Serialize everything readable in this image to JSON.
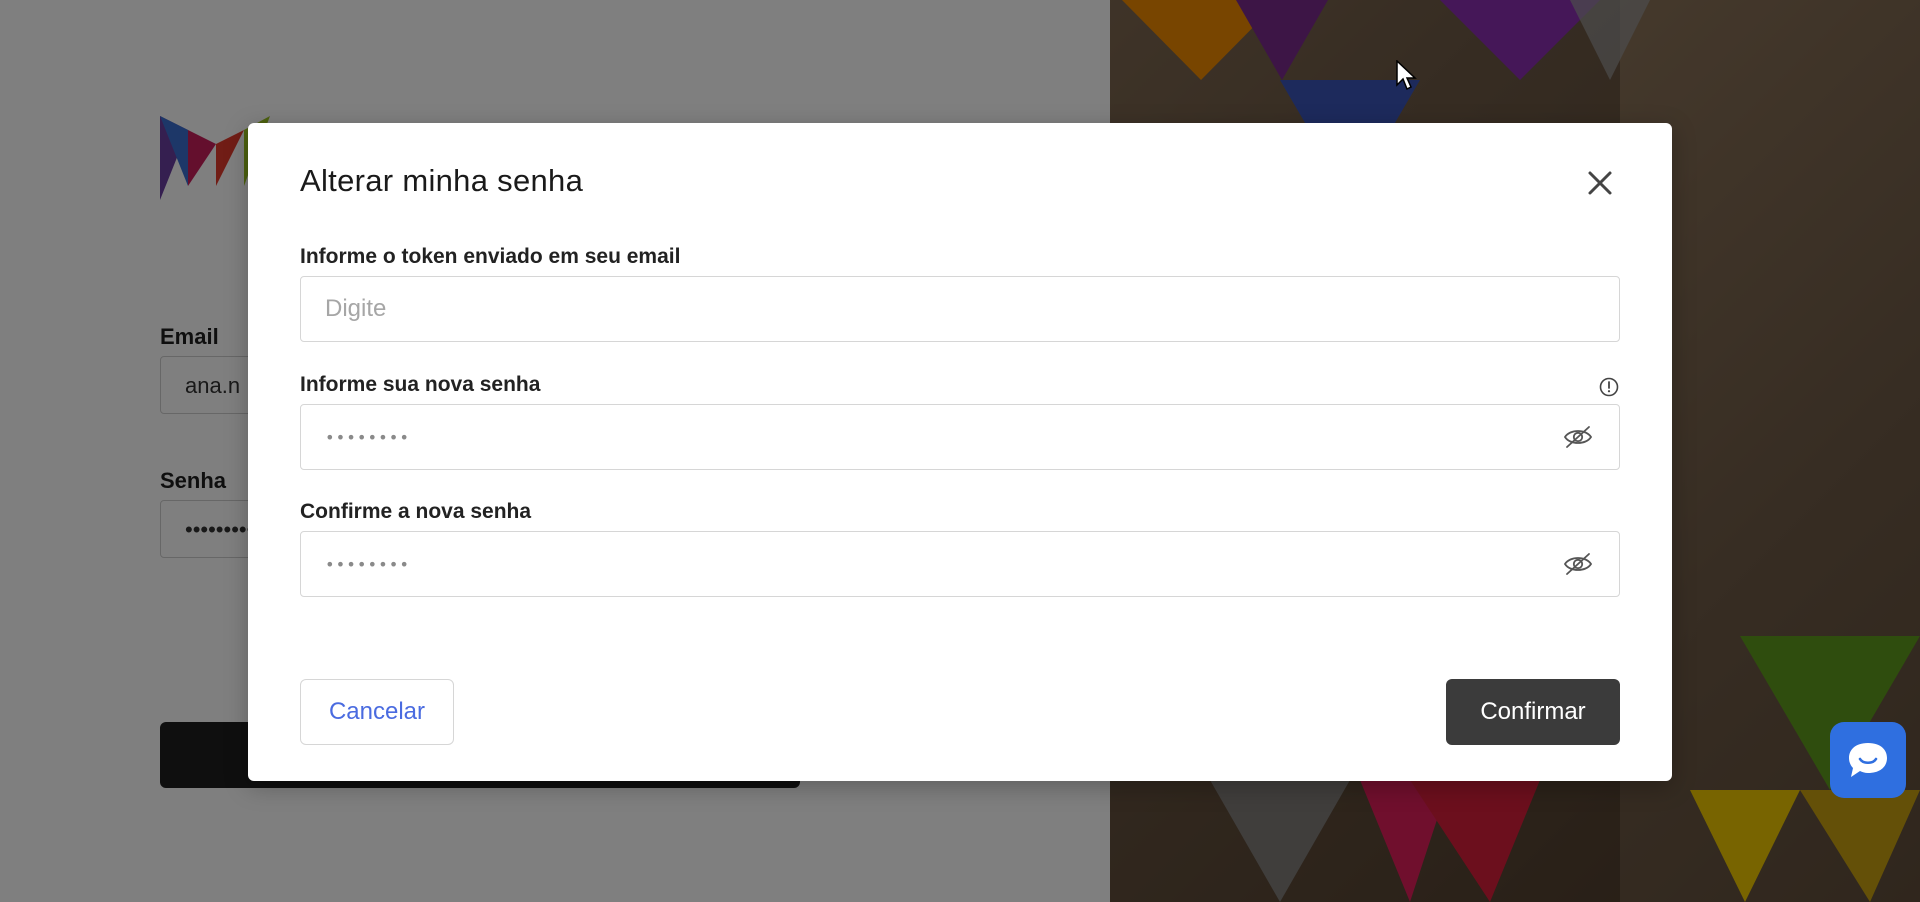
{
  "background": {
    "email_label": "Email",
    "email_value": "ana.n",
    "password_label": "Senha",
    "password_value": "•••••••••"
  },
  "modal": {
    "title": "Alterar minha senha",
    "close_icon": "close-icon",
    "token_label": "Informe o token enviado em seu email",
    "token_placeholder": "Digite",
    "new_password_label": "Informe sua nova senha",
    "new_password_value": "••••••••",
    "info_icon": "info-circle-icon",
    "confirm_password_label": "Confirme a nova senha",
    "confirm_password_value": "••••••••",
    "eye_icon": "eye-off-icon",
    "cancel_label": "Cancelar",
    "confirm_label": "Confirmar"
  },
  "colors": {
    "overlay": "#000000",
    "primary_button": "#3b3b3b",
    "link_text": "#4a6be0",
    "chat_button": "#2f6fe0"
  },
  "chat": {
    "icon": "chat-bubble-icon"
  }
}
